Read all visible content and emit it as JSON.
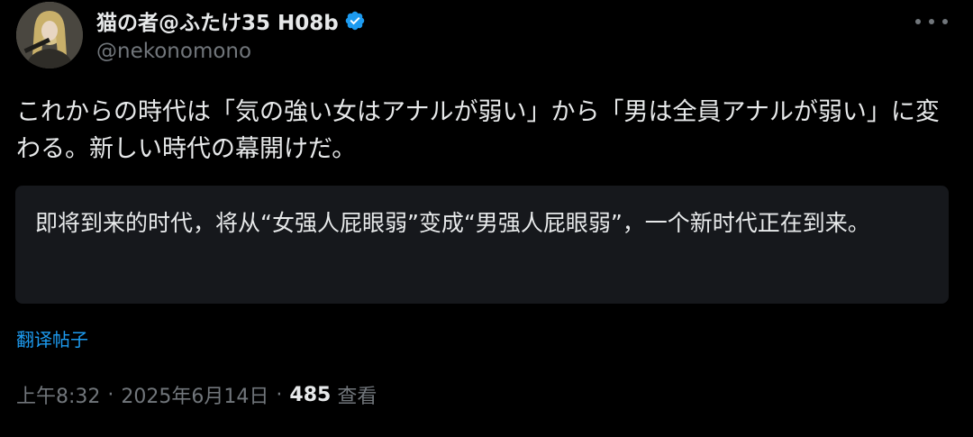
{
  "author": {
    "display_name": "猫の者@ふたけ35 H08b",
    "handle": "@nekonomono",
    "verified_icon": "verified-badge-icon",
    "avatar_icon": "avatar-image"
  },
  "tweet": {
    "text": "これからの時代は「気の強い女はアナルが弱い」から「男は全員アナルが弱い」に変わる。新しい時代の幕開けだ。"
  },
  "translation": {
    "text": "即将到来的时代，将从“女强人屁眼弱”变成“男强人屁眼弱”，一个新时代正在到来。",
    "link_label": "翻译帖子"
  },
  "meta": {
    "time": "上午8:32",
    "date": "2025年6月14日",
    "separator": "·",
    "views_count": "485",
    "views_label": "查看"
  },
  "colors": {
    "background": "#000000",
    "primary_text": "#e7e9ea",
    "secondary_text": "#71767b",
    "link": "#1d9bf0",
    "translation_bg": "#16181c"
  }
}
